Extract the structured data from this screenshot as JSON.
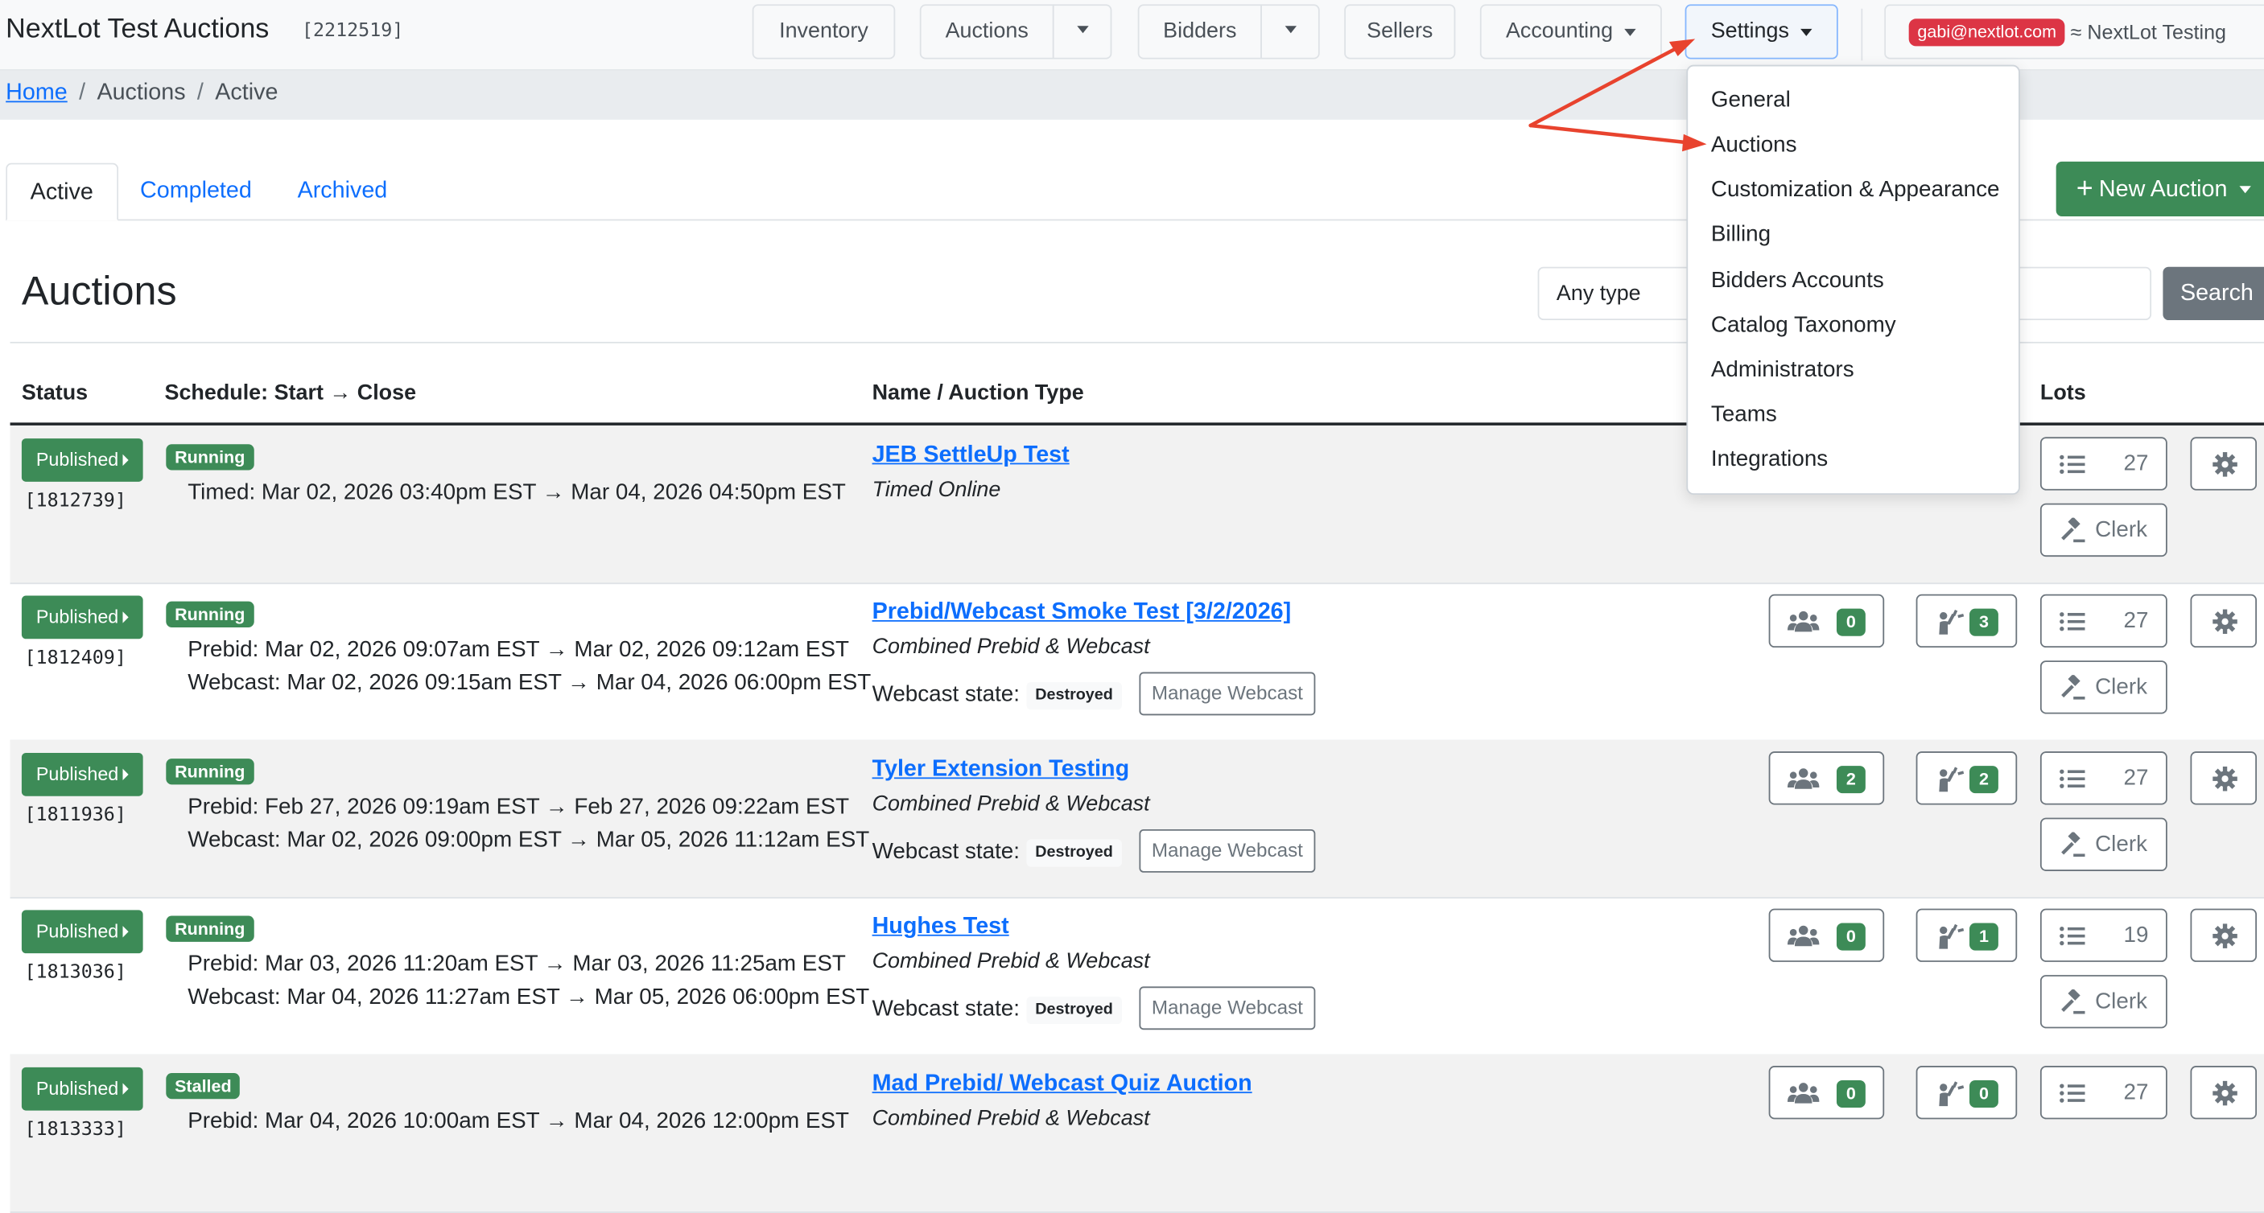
{
  "header": {
    "brand": "NextLot Test Auctions",
    "brand_id": "[2212519]",
    "nav": {
      "inventory": "Inventory",
      "auctions": "Auctions",
      "bidders": "Bidders",
      "sellers": "Sellers",
      "accounting": "Accounting",
      "settings": "Settings"
    },
    "user_email": "gabi@nextlot.com",
    "org_name": "≈ NextLot Testing"
  },
  "breadcrumb": {
    "home": "Home",
    "section": "Auctions",
    "current": "Active"
  },
  "tabs": {
    "active": "Active",
    "completed": "Completed",
    "archived": "Archived"
  },
  "new_auction_label": "New Auction",
  "page_title": "Auctions",
  "filter": {
    "type_value": "Any type",
    "search_label": "Search"
  },
  "table": {
    "headers": {
      "status": "Status",
      "schedule": "Schedule: Start → Close",
      "name": "Name / Auction Type",
      "lots": "Lots"
    },
    "published_label": "Published",
    "webcast_state_label": "Webcast state:",
    "manage_webcast_label": "Manage Webcast",
    "clerk_label": "Clerk",
    "rows": [
      {
        "id": "[1812739]",
        "state": "Running",
        "schedule1": "Timed: Mar 02, 2026 03:40pm EST → Mar 04, 2026 04:50pm EST",
        "schedule2": "",
        "name": "JEB SettleUp Test",
        "type": "Timed Online",
        "webcast_state": "",
        "bidders": "",
        "bids": "",
        "lots": "27"
      },
      {
        "id": "[1812409]",
        "state": "Running",
        "schedule1": "Prebid: Mar 02, 2026 09:07am EST → Mar 02, 2026 09:12am EST",
        "schedule2": "Webcast: Mar 02, 2026 09:15am EST → Mar 04, 2026 06:00pm EST",
        "name": "Prebid/Webcast Smoke Test [3/2/2026]",
        "type": "Combined Prebid & Webcast",
        "webcast_state": "Destroyed",
        "bidders": "0",
        "bids": "3",
        "lots": "27"
      },
      {
        "id": "[1811936]",
        "state": "Running",
        "schedule1": "Prebid: Feb 27, 2026 09:19am EST → Feb 27, 2026 09:22am EST",
        "schedule2": "Webcast: Mar 02, 2026 09:00pm EST → Mar 05, 2026 11:12am EST",
        "name": "Tyler Extension Testing",
        "type": "Combined Prebid & Webcast",
        "webcast_state": "Destroyed",
        "bidders": "2",
        "bids": "2",
        "lots": "27"
      },
      {
        "id": "[1813036]",
        "state": "Running",
        "schedule1": "Prebid: Mar 03, 2026 11:20am EST → Mar 03, 2026 11:25am EST",
        "schedule2": "Webcast: Mar 04, 2026 11:27am EST → Mar 05, 2026 06:00pm EST",
        "name": "Hughes Test",
        "type": "Combined Prebid & Webcast",
        "webcast_state": "Destroyed",
        "bidders": "0",
        "bids": "1",
        "lots": "19"
      },
      {
        "id": "[1813333]",
        "state": "Stalled",
        "schedule1": "Prebid: Mar 04, 2026 10:00am EST → Mar 04, 2026 12:00pm EST",
        "schedule2": "",
        "name": "Mad Prebid/ Webcast Quiz Auction",
        "type": "Combined Prebid & Webcast",
        "webcast_state": "",
        "bidders": "0",
        "bids": "0",
        "lots": "27"
      }
    ]
  },
  "settings_menu": [
    "General",
    "Auctions",
    "Customization & Appearance",
    "Billing",
    "Bidders Accounts",
    "Catalog Taxonomy",
    "Administrators",
    "Teams",
    "Integrations"
  ],
  "icons": {
    "bidders": "users-icon",
    "bids": "hand-raise-icon",
    "lots": "list-icon",
    "clerk": "gavel-icon",
    "actions": "gear-icon",
    "caret": "caret-down-icon"
  },
  "colors": {
    "primary": "#0d6efd",
    "success": "#3d8b57",
    "danger": "#dc3545",
    "secondary": "#6c757d",
    "annotation_arrow": "#e8432e"
  }
}
